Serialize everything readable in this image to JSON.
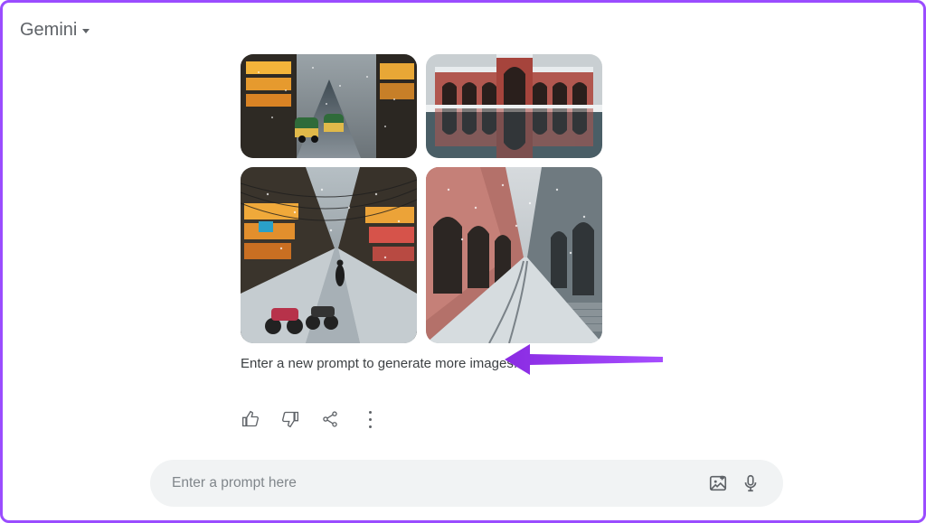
{
  "header": {
    "app_name": "Gemini"
  },
  "response": {
    "hint": "Enter a new prompt to generate more images.",
    "actions": {
      "thumbs_up": "thumbs-up",
      "thumbs_down": "thumbs-down",
      "share": "share",
      "more": "more"
    }
  },
  "prompt": {
    "placeholder": "Enter a prompt here",
    "value": ""
  },
  "icons": {
    "image": "image-plus",
    "mic": "microphone"
  }
}
